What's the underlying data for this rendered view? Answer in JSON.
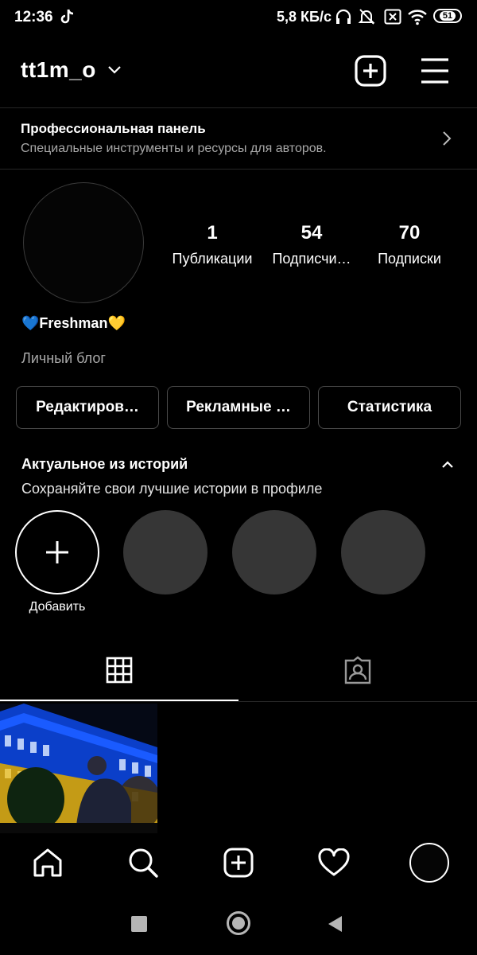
{
  "status_bar": {
    "time": "12:36",
    "net_speed": "5,8 КБ/с",
    "battery": "51",
    "icons": [
      "tiktok-icon",
      "headphones-icon",
      "bell-muted-icon",
      "sim-x-icon",
      "wifi-icon",
      "battery-icon"
    ]
  },
  "header": {
    "username": "tt1m_o",
    "icons": [
      "chevron-down-icon",
      "new-post-icon",
      "menu-icon"
    ]
  },
  "pro_panel": {
    "title": "Профессиональная панель",
    "subtitle": "Специальные инструменты и ресурсы для авторов."
  },
  "profile": {
    "stats": [
      {
        "value": "1",
        "label": "Публикации"
      },
      {
        "value": "54",
        "label": "Подписчи…"
      },
      {
        "value": "70",
        "label": "Подписки"
      }
    ],
    "display_name": "💙Freshman💛",
    "category": "Личный блог"
  },
  "buttons": {
    "edit": "Редактиров…",
    "promo": "Рекламные …",
    "stats": "Статистика"
  },
  "highlights": {
    "title": "Актуальное из историй",
    "subtitle": "Сохраняйте свои лучшие истории в профиле",
    "add_label": "Добавить"
  },
  "tabs": {
    "items": [
      "grid-icon",
      "tagged-icon"
    ],
    "active": "grid-icon"
  },
  "bottom_nav": [
    "home-icon",
    "search-icon",
    "create-icon",
    "heart-icon",
    "profile-avatar"
  ],
  "colors": {
    "background": "#000000",
    "muted_text": "#a8a8a8",
    "highlight_placeholder": "#363636"
  }
}
